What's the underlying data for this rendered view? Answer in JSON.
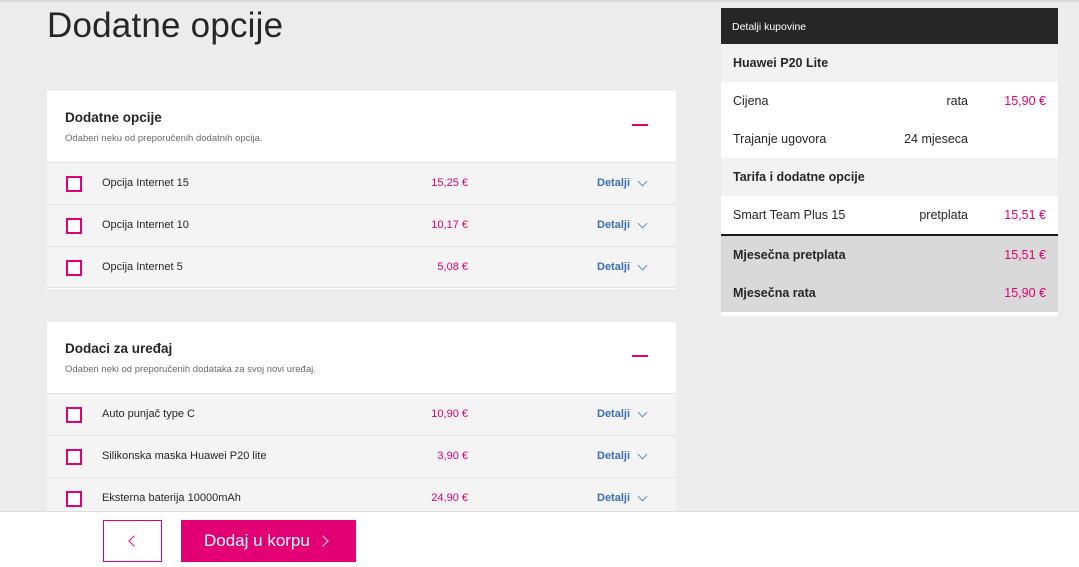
{
  "page": {
    "title": "Dodatne opcije"
  },
  "sections": [
    {
      "title": "Dodatne opcije",
      "subtitle": "Odaberi neku od preporučenih dodatnih opcija.",
      "items": [
        {
          "name": "Opcija Internet 15",
          "price": "15,25 €",
          "details": "Detalji",
          "checked": false
        },
        {
          "name": "Opcija Internet 10",
          "price": "10,17 €",
          "details": "Detalji",
          "checked": false
        },
        {
          "name": "Opcija Internet 5",
          "price": "5,08 €",
          "details": "Detalji",
          "checked": false
        }
      ]
    },
    {
      "title": "Dodaci za uređaj",
      "subtitle": "Odaberi neki od preporučenih dodataka za svoj novi uređaj.",
      "items": [
        {
          "name": "Auto punjač type C",
          "price": "10,90 €",
          "details": "Detalji",
          "checked": false
        },
        {
          "name": "Silikonska maska Huawei P20 lite",
          "price": "3,90 €",
          "details": "Detalji",
          "checked": false
        },
        {
          "name": "Eksterna baterija 10000mAh",
          "price": "24,90 €",
          "details": "Detalji",
          "checked": false
        }
      ]
    }
  ],
  "summary": {
    "header": "Detalji kupovine",
    "device": "Huawei P20 Lite",
    "price_label": "Cijena",
    "price_type": "rata",
    "price_value": "15,90 €",
    "duration_label": "Trajanje ugovora",
    "duration_value": "24 mjeseca",
    "tariff_section": "Tarifa i dodatne opcije",
    "tariff_name": "Smart Team Plus 15",
    "tariff_type": "pretplata",
    "tariff_value": "15,51 €",
    "monthly_sub_label": "Mjesečna pretplata",
    "monthly_sub_value": "15,51 €",
    "monthly_rate_label": "Mjesečna rata",
    "monthly_rate_value": "15,90 €"
  },
  "footer": {
    "add_label": "Dodaj u korpu"
  },
  "colors": {
    "accent": "#e20074",
    "link": "#3c6fb5",
    "dark": "#262626"
  },
  "icons": {
    "back": "chevron-left-icon",
    "forward": "chevron-right-icon",
    "collapse": "minus-icon",
    "details": "chevron-down-icon"
  }
}
